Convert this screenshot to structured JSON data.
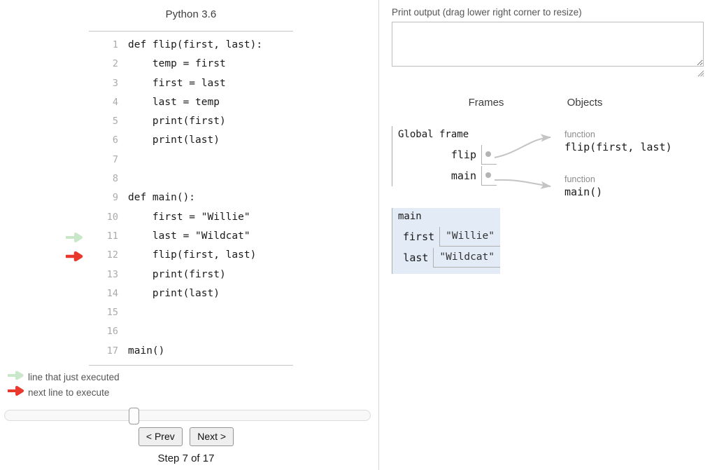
{
  "editor": {
    "language_label": "Python 3.6",
    "lines": [
      {
        "num": "1",
        "text": "def flip(first, last):",
        "arrow": ""
      },
      {
        "num": "2",
        "text": "    temp = first",
        "arrow": ""
      },
      {
        "num": "3",
        "text": "    first = last",
        "arrow": ""
      },
      {
        "num": "4",
        "text": "    last = temp",
        "arrow": ""
      },
      {
        "num": "5",
        "text": "    print(first)",
        "arrow": ""
      },
      {
        "num": "6",
        "text": "    print(last)",
        "arrow": ""
      },
      {
        "num": "7",
        "text": "",
        "arrow": ""
      },
      {
        "num": "8",
        "text": "",
        "arrow": ""
      },
      {
        "num": "9",
        "text": "def main():",
        "arrow": ""
      },
      {
        "num": "10",
        "text": "    first = \"Willie\"",
        "arrow": ""
      },
      {
        "num": "11",
        "text": "    last = \"Wildcat\"",
        "arrow": "executed"
      },
      {
        "num": "12",
        "text": "    flip(first, last)",
        "arrow": "next"
      },
      {
        "num": "13",
        "text": "    print(first)",
        "arrow": ""
      },
      {
        "num": "14",
        "text": "    print(last)",
        "arrow": ""
      },
      {
        "num": "15",
        "text": "",
        "arrow": ""
      },
      {
        "num": "16",
        "text": "",
        "arrow": ""
      },
      {
        "num": "17",
        "text": "main()",
        "arrow": ""
      }
    ]
  },
  "legend": {
    "executed_label": "line that just executed",
    "next_label": "next line to execute"
  },
  "controls": {
    "prev_label": "< Prev",
    "next_label": "Next >",
    "step_label": "Step 7 of 17",
    "step_current": 7,
    "step_total": 17,
    "slider_percent": 35
  },
  "output": {
    "label": "Print output (drag lower right corner to resize)",
    "value": "",
    "placeholder": ""
  },
  "visualization": {
    "frames_title": "Frames",
    "objects_title": "Objects",
    "global_frame": {
      "title": "Global frame",
      "variables": [
        {
          "name": "flip",
          "value": ""
        },
        {
          "name": "main",
          "value": ""
        }
      ]
    },
    "stack_frames": [
      {
        "title": "main",
        "variables": [
          {
            "name": "first",
            "value": "\"Willie\""
          },
          {
            "name": "last",
            "value": "\"Wildcat\""
          }
        ]
      }
    ],
    "heap_objects": [
      {
        "type": "function",
        "signature": "flip(first, last)"
      },
      {
        "type": "function",
        "signature": "main()"
      }
    ]
  },
  "colors": {
    "executed_arrow": "#c9e7c9",
    "next_arrow": "#e8392c",
    "frame_fill": "#e2ebf6",
    "connector": "#c4c4c4",
    "divider": "#d8d8d8"
  }
}
